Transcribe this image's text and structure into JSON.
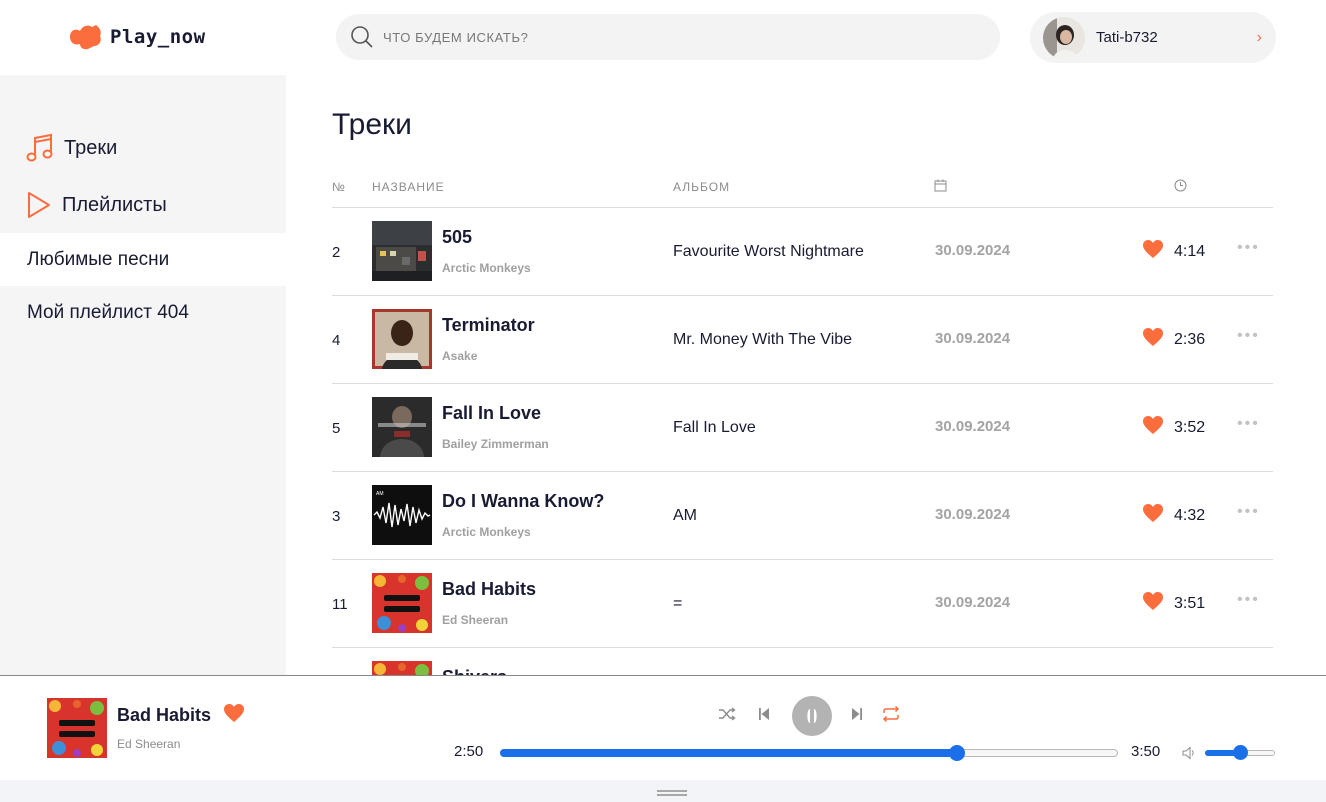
{
  "app": {
    "logo_text": "Play_now",
    "accent": "#fc6d3e",
    "progress_color": "#1b6fe8"
  },
  "search": {
    "placeholder": "ЧТО БУДЕМ ИСКАТЬ?",
    "value": ""
  },
  "user": {
    "name": "Tati-b732"
  },
  "sidebar": {
    "nav": [
      {
        "label": "Треки",
        "icon": "music-note-icon"
      },
      {
        "label": "Плейлисты",
        "icon": "play-icon"
      }
    ],
    "playlists": [
      {
        "label": "Любимые песни",
        "active": true
      },
      {
        "label": "Мой плейлист 404",
        "active": false
      }
    ]
  },
  "main": {
    "title": "Треки",
    "columns": {
      "num": "№",
      "name": "НАЗВАНИЕ",
      "album": "АЛЬБОМ",
      "date_icon": "calendar-icon",
      "duration_icon": "clock-icon"
    },
    "tracks": [
      {
        "num": "2",
        "title": "505",
        "artist": "Arctic Monkeys",
        "album": "Favourite Worst Nightmare",
        "date": "30.09.2024",
        "duration": "4:14",
        "liked": true
      },
      {
        "num": "4",
        "title": "Terminator",
        "artist": "Asake",
        "album": "Mr. Money With The Vibe",
        "date": "30.09.2024",
        "duration": "2:36",
        "liked": true
      },
      {
        "num": "5",
        "title": "Fall In Love",
        "artist": "Bailey Zimmerman",
        "album": "Fall In Love",
        "date": "30.09.2024",
        "duration": "3:52",
        "liked": true
      },
      {
        "num": "3",
        "title": "Do I Wanna Know?",
        "artist": "Arctic Monkeys",
        "album": "AM",
        "date": "30.09.2024",
        "duration": "4:32",
        "liked": true
      },
      {
        "num": "11",
        "title": "Bad Habits",
        "artist": "Ed Sheeran",
        "album": "=",
        "date": "30.09.2024",
        "duration": "3:51",
        "liked": true
      },
      {
        "num": "",
        "title": "Shivers",
        "artist": "",
        "album": "",
        "date": "",
        "duration": "",
        "liked": true
      }
    ],
    "more_label": "•••"
  },
  "player": {
    "title": "Bad Habits",
    "artist": "Ed Sheeran",
    "liked": true,
    "current_time": "2:50",
    "total_time": "3:50",
    "progress": 0.74,
    "volume": 0.5,
    "shuffle_active": false,
    "repeat_active": true
  }
}
